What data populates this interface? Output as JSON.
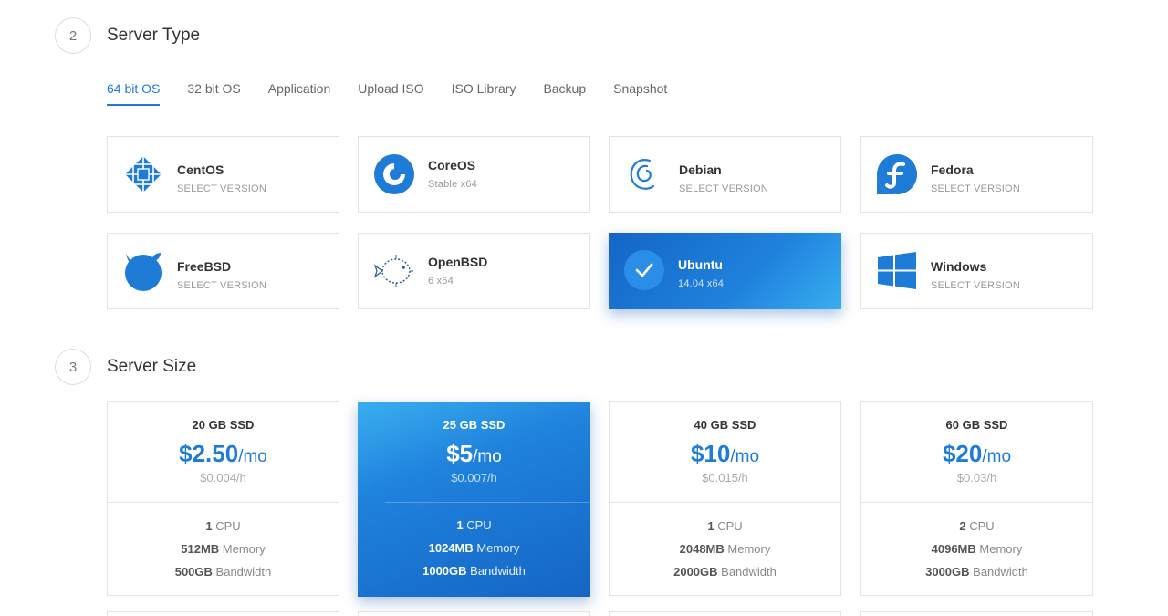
{
  "server_type": {
    "step": "2",
    "title": "Server Type",
    "tabs": [
      "64 bit OS",
      "32 bit OS",
      "Application",
      "Upload ISO",
      "ISO Library",
      "Backup",
      "Snapshot"
    ],
    "os": [
      {
        "name": "CentOS",
        "sub": "SELECT VERSION",
        "icon": "centos-icon"
      },
      {
        "name": "CoreOS",
        "sub": "Stable  x64",
        "icon": "coreos-icon"
      },
      {
        "name": "Debian",
        "sub": "SELECT VERSION",
        "icon": "debian-icon"
      },
      {
        "name": "Fedora",
        "sub": "SELECT VERSION",
        "icon": "fedora-icon"
      },
      {
        "name": "FreeBSD",
        "sub": "SELECT VERSION",
        "icon": "freebsd-icon"
      },
      {
        "name": "OpenBSD",
        "sub": "6  x64",
        "icon": "openbsd-icon"
      },
      {
        "name": "Ubuntu",
        "sub": "14.04  x64",
        "icon": "check-icon"
      },
      {
        "name": "Windows",
        "sub": "SELECT VERSION",
        "icon": "windows-icon"
      }
    ],
    "selected": "Ubuntu"
  },
  "server_size": {
    "step": "3",
    "title": "Server Size",
    "plans": [
      {
        "ssd": "20 GB SSD",
        "price": "$2.50",
        "per": "/mo",
        "hourly": "$0.004/h",
        "cpu": "1",
        "cpu_label": "CPU",
        "memory": "512MB",
        "memory_label": "Memory",
        "bandwidth": "500GB",
        "bandwidth_label": "Bandwidth"
      },
      {
        "ssd": "25 GB SSD",
        "price": "$5",
        "per": "/mo",
        "hourly": "$0.007/h",
        "cpu": "1",
        "cpu_label": "CPU",
        "memory": "1024MB",
        "memory_label": "Memory",
        "bandwidth": "1000GB",
        "bandwidth_label": "Bandwidth"
      },
      {
        "ssd": "40 GB SSD",
        "price": "$10",
        "per": "/mo",
        "hourly": "$0.015/h",
        "cpu": "1",
        "cpu_label": "CPU",
        "memory": "2048MB",
        "memory_label": "Memory",
        "bandwidth": "2000GB",
        "bandwidth_label": "Bandwidth"
      },
      {
        "ssd": "60 GB SSD",
        "price": "$20",
        "per": "/mo",
        "hourly": "$0.03/h",
        "cpu": "2",
        "cpu_label": "CPU",
        "memory": "4096MB",
        "memory_label": "Memory",
        "bandwidth": "3000GB",
        "bandwidth_label": "Bandwidth"
      }
    ],
    "selected": "25 GB SSD"
  },
  "colors": {
    "accent": "#1e7bd6",
    "selected_start": "#1565c5",
    "selected_end": "#39aef0"
  }
}
